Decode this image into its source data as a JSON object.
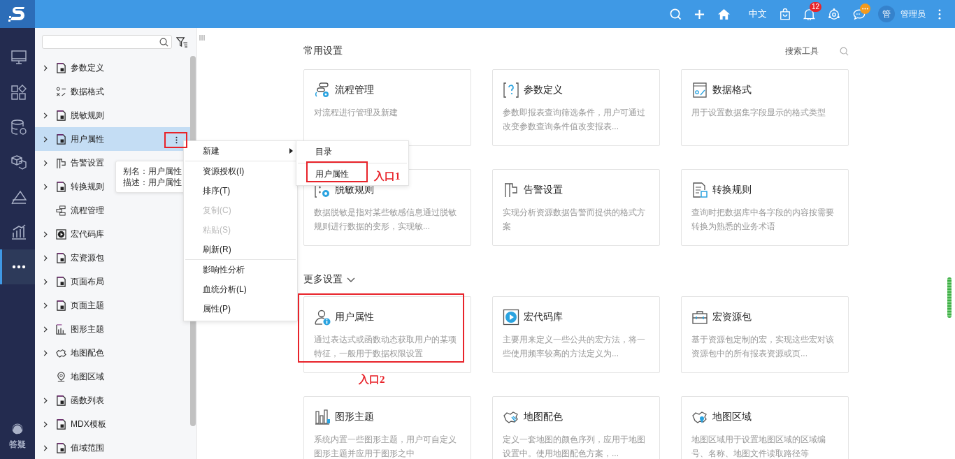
{
  "topbar": {
    "language": "中文",
    "notifications_badge": "12",
    "avatar": "管",
    "user": "管理员"
  },
  "rail": {
    "items": [
      {
        "selected": false
      },
      {
        "selected": false
      },
      {
        "selected": false
      },
      {
        "selected": false
      },
      {
        "selected": false
      },
      {
        "selected": false
      },
      {
        "selected": true
      }
    ],
    "help": "答疑"
  },
  "tree": {
    "items": [
      {
        "label": "参数定义",
        "expandable": true,
        "selected": false
      },
      {
        "label": "数据格式",
        "expandable": false,
        "selected": false
      },
      {
        "label": "脱敏规则",
        "expandable": true,
        "selected": false
      },
      {
        "label": "用户属性",
        "expandable": true,
        "selected": true
      },
      {
        "label": "告警设置",
        "expandable": true,
        "selected": false
      },
      {
        "label": "转换规则",
        "expandable": true,
        "selected": false
      },
      {
        "label": "流程管理",
        "expandable": false,
        "selected": false
      },
      {
        "label": "宏代码库",
        "expandable": true,
        "selected": false
      },
      {
        "label": "宏资源包",
        "expandable": true,
        "selected": false
      },
      {
        "label": "页面布局",
        "expandable": true,
        "selected": false
      },
      {
        "label": "页面主题",
        "expandable": true,
        "selected": false
      },
      {
        "label": "图形主题",
        "expandable": true,
        "selected": false
      },
      {
        "label": "地图配色",
        "expandable": true,
        "selected": false
      },
      {
        "label": "地图区域",
        "expandable": false,
        "selected": false
      },
      {
        "label": "函数列表",
        "expandable": true,
        "selected": false
      },
      {
        "label": "MDX模板",
        "expandable": true,
        "selected": false
      },
      {
        "label": "值域范围",
        "expandable": true,
        "selected": false
      }
    ],
    "tooltip": {
      "alias": "别名：用户属性",
      "description": "描述：用户属性"
    }
  },
  "context_menu": {
    "groups": [
      [
        {
          "label": "新建",
          "disabled": false,
          "submenu": true
        }
      ],
      [
        {
          "label": "资源授权(I)",
          "disabled": false,
          "submenu": false
        },
        {
          "label": "排序(T)",
          "disabled": false,
          "submenu": false
        },
        {
          "label": "复制(C)",
          "disabled": true,
          "submenu": false
        },
        {
          "label": "粘贴(S)",
          "disabled": true,
          "submenu": false
        },
        {
          "label": "刷新(R)",
          "disabled": false,
          "submenu": false
        }
      ],
      [
        {
          "label": "影响性分析",
          "disabled": false,
          "submenu": false
        },
        {
          "label": "血统分析(L)",
          "disabled": false,
          "submenu": false
        },
        {
          "label": "属性(P)",
          "disabled": false,
          "submenu": false
        }
      ]
    ],
    "submenu": [
      {
        "label": "目录"
      },
      {
        "label": "用户属性"
      }
    ]
  },
  "common_settings": {
    "title": "常用设置",
    "search_label": "搜索工具",
    "cards": [
      {
        "title": "流程管理",
        "description": "对流程进行管理及新建"
      },
      {
        "title": "参数定义",
        "description": "参数即报表查询筛选条件，用户可通过改变参数查询条件值改变报表..."
      },
      {
        "title": "数据格式",
        "description": "用于设置数据集字段显示的格式类型"
      },
      {
        "title": "脱敏规则",
        "description": "数据脱敏是指对某些敏感信息通过脱敏规则进行数据的变形，实现敏..."
      },
      {
        "title": "告警设置",
        "description": "实现分析资源数据告警而提供的格式方案"
      },
      {
        "title": "转换规则",
        "description": "查询时把数据库中各字段的内容按需要转换为熟悉的业务术语"
      }
    ]
  },
  "more_settings": {
    "title": "更多设置",
    "expanded": true,
    "cards": [
      {
        "title": "用户属性",
        "description": "通过表达式或函数动态获取用户的某项特征，一般用于数据权限设置"
      },
      {
        "title": "宏代码库",
        "description": "主要用来定义一些公共的宏方法，将一些使用频率较高的方法定义为..."
      },
      {
        "title": "宏资源包",
        "description": "基于资源包定制的宏，实现这些宏对该资源包中的所有报表资源或页..."
      },
      {
        "title": "图形主题",
        "description": "系统内置一些图形主题，用户可自定义图形主题并应用于图形之中"
      },
      {
        "title": "地图配色",
        "description": "定义一套地图的颜色序列，应用于地图设置中。使用地图配色方案，..."
      },
      {
        "title": "地图区域",
        "description": "地图区域用于设置地图区域的区域编号、名称、地图文件读取路径等"
      }
    ]
  },
  "annotations": [
    {
      "text": "入口1"
    },
    {
      "text": "入口2"
    }
  ]
}
